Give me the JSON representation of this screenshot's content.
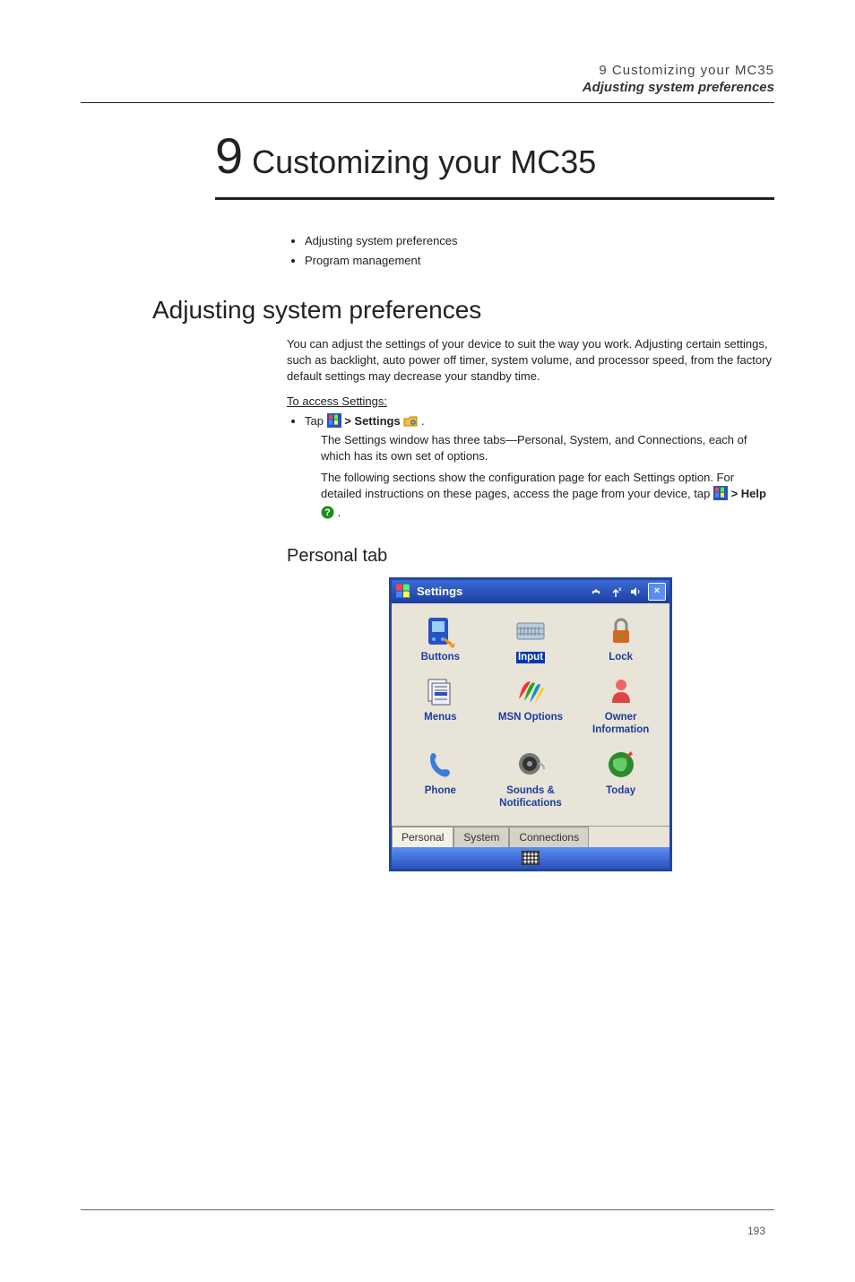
{
  "header": {
    "running_head": "9 Customizing your MC35",
    "running_sub": "Adjusting system preferences"
  },
  "chapter": {
    "number": "9",
    "title": "Customizing your MC35"
  },
  "toc_bullets": [
    "Adjusting system preferences",
    "Program management"
  ],
  "section1": {
    "heading": "Adjusting system preferences",
    "para": "You can adjust the settings of your device to suit the way you work. Adjusting certain settings, such as backlight, auto power off timer, system volume, and processor speed, from the factory default settings may decrease your standby time.",
    "proc_head": "To access Settings:",
    "step_lead": "Tap ",
    "step_mid": " > Settings ",
    "step_end": ".",
    "sub1": "The Settings window has three tabs—Personal, System, and Connections, each of which has its own set of options.",
    "sub2_a": "The following sections show the configuration page for each Settings option. For detailed instructions on these pages, access the page from your device, tap ",
    "sub2_b": " > Help ",
    "sub2_c": "."
  },
  "subsection": {
    "heading": "Personal tab"
  },
  "device": {
    "title": "Settings",
    "items": [
      {
        "label": "Buttons",
        "icon": "buttons-icon"
      },
      {
        "label": "Input",
        "icon": "input-icon"
      },
      {
        "label": "Lock",
        "icon": "lock-icon"
      },
      {
        "label": "Menus",
        "icon": "menus-icon"
      },
      {
        "label": "MSN Options",
        "icon": "msn-icon"
      },
      {
        "label": "Owner Information",
        "icon": "owner-icon"
      },
      {
        "label": "Phone",
        "icon": "phone-icon"
      },
      {
        "label": "Sounds & Notifications",
        "icon": "sounds-icon"
      },
      {
        "label": "Today",
        "icon": "today-icon"
      }
    ],
    "tabs": [
      "Personal",
      "System",
      "Connections"
    ],
    "ok": "×"
  },
  "page_number": "193"
}
